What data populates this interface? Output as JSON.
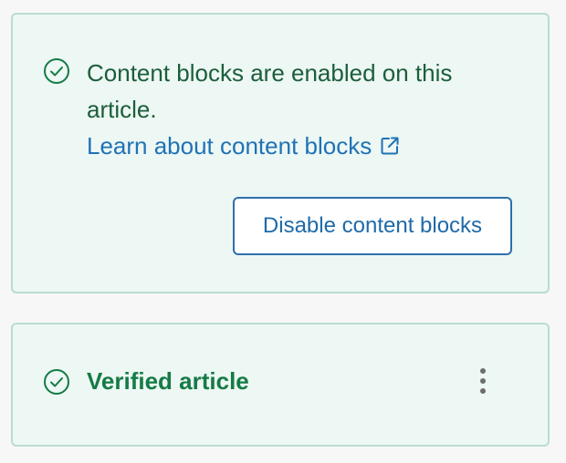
{
  "content_blocks_card": {
    "status_icon": "check-circle-icon",
    "message": "Content blocks are enabled on this article.",
    "learn_link": {
      "label": "Learn about content blocks",
      "icon": "external-link-icon"
    },
    "disable_button_label": "Disable content blocks"
  },
  "verified_card": {
    "status_icon": "check-circle-icon",
    "label": "Verified article",
    "menu_icon": "more-vertical-icon"
  },
  "colors": {
    "card_background": "#edf7f3",
    "card_border": "#b9ddd0",
    "success_green": "#157b46",
    "message_text": "#1b5e3b",
    "link_blue": "#1f72b6",
    "button_border": "#2d70ad"
  }
}
